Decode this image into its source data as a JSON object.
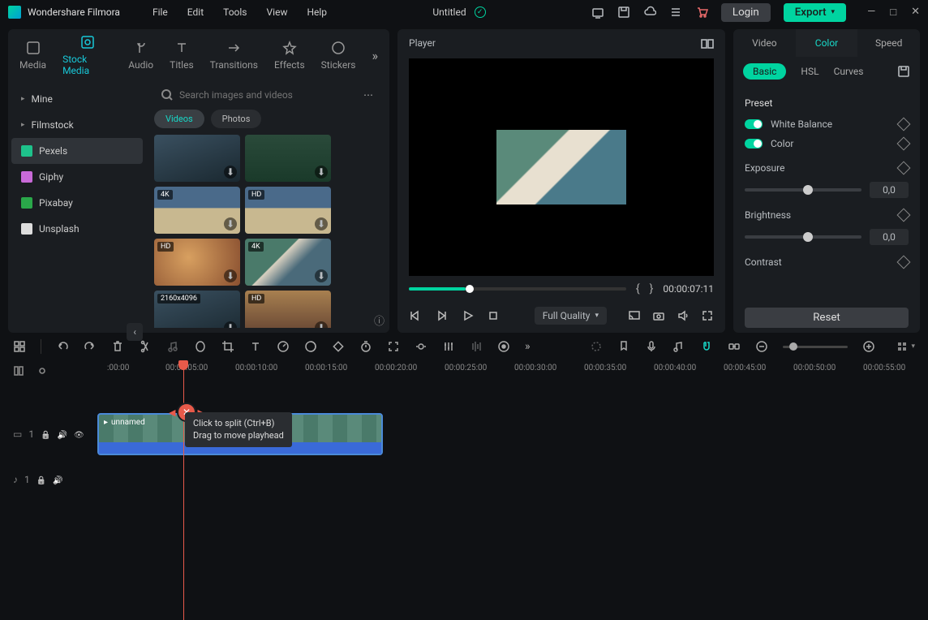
{
  "app": {
    "name": "Wondershare Filmora"
  },
  "menu": [
    "File",
    "Edit",
    "Tools",
    "View",
    "Help"
  ],
  "doc": {
    "title": "Untitled"
  },
  "header": {
    "login": "Login",
    "export": "Export"
  },
  "mediaTabs": [
    "Media",
    "Stock Media",
    "Audio",
    "Titles",
    "Transitions",
    "Effects",
    "Stickers"
  ],
  "mediaTabsActive": 1,
  "sources": [
    {
      "label": "Mine",
      "expandable": true
    },
    {
      "label": "Filmstock",
      "expandable": true
    },
    {
      "label": "Pexels",
      "expandable": false,
      "active": true,
      "color": "#1ec28b"
    },
    {
      "label": "Giphy",
      "expandable": false,
      "color": "#c86ad8"
    },
    {
      "label": "Pixabay",
      "expandable": false,
      "color": "#2aa84a"
    },
    {
      "label": "Unsplash",
      "expandable": false,
      "color": "#e8e8e8"
    }
  ],
  "search": {
    "placeholder": "Search images and videos"
  },
  "browserTabs": [
    "Videos",
    "Photos"
  ],
  "browserTabsActive": 0,
  "thumbs": [
    {
      "badge": ""
    },
    {
      "badge": ""
    },
    {
      "badge": "4K"
    },
    {
      "badge": "HD"
    },
    {
      "badge": "HD"
    },
    {
      "badge": "4K"
    },
    {
      "badge": "2160x4096"
    },
    {
      "badge": "HD"
    }
  ],
  "player": {
    "title": "Player",
    "timecode": "00:00:07:11",
    "quality": "Full Quality"
  },
  "inspector": {
    "tabs": [
      "Video",
      "Color",
      "Speed"
    ],
    "tabsActive": 1,
    "subtabs": [
      "Basic",
      "HSL",
      "Curves"
    ],
    "subtabsActive": 0,
    "preset": "Preset",
    "whiteBalance": "White Balance",
    "colorLabel": "Color",
    "exposure": {
      "label": "Exposure",
      "value": "0,0"
    },
    "brightness": {
      "label": "Brightness",
      "value": "0,0"
    },
    "contrast": {
      "label": "Contrast"
    },
    "reset": "Reset"
  },
  "timeline": {
    "ticks": [
      ":00:00",
      "00:00:05:00",
      "00:00:10:00",
      "00:00:15:00",
      "00:00:20:00",
      "00:00:25:00",
      "00:00:30:00",
      "00:00:35:00",
      "00:00:40:00",
      "00:00:45:00",
      "00:00:50:00",
      "00:00:55:00"
    ],
    "clipName": "unnamed",
    "tooltip1": "Click to split (Ctrl+B)",
    "tooltip2": "Drag to move playhead",
    "videoTrack": "1",
    "audioTrack": "1"
  }
}
